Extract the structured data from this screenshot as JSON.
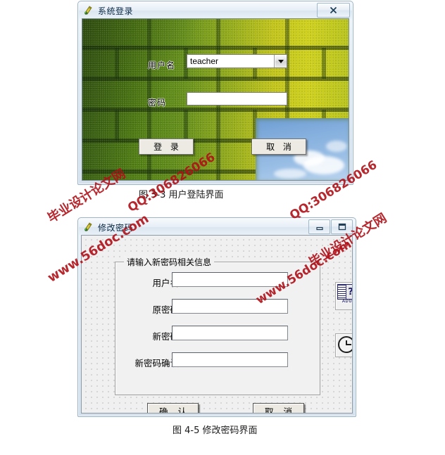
{
  "figures": [
    {
      "caption": "图 3-3 用户登陆界面",
      "window": {
        "title": "系统登录",
        "icon": "vb-form-icon",
        "buttons": [
          {
            "name": "close",
            "glyph": "✕"
          }
        ],
        "fields": [
          {
            "label": "用户名",
            "type": "combobox",
            "value": "teacher",
            "placeholder": ""
          },
          {
            "label": "密码",
            "type": "password",
            "value": "",
            "placeholder": ""
          }
        ],
        "actions": [
          {
            "name": "login",
            "label": "登 录"
          },
          {
            "name": "cancel",
            "label": "取 消"
          }
        ]
      }
    },
    {
      "caption": "图 4-5 修改密码界面",
      "window": {
        "title": "修改密码",
        "icon": "vb-form-icon",
        "buttons": [
          {
            "name": "minimize",
            "glyph": "—"
          },
          {
            "name": "maximize",
            "glyph": "▭"
          }
        ],
        "groupbox_title": "请输入新密码相关信息",
        "fields": [
          {
            "label": "用户名",
            "type": "text",
            "value": "",
            "placeholder": ""
          },
          {
            "label": "原密码",
            "type": "password",
            "value": "",
            "placeholder": ""
          },
          {
            "label": "新密码",
            "type": "password",
            "value": "",
            "placeholder": ""
          },
          {
            "label": "新密码确认",
            "type": "password",
            "value": "",
            "placeholder": ""
          }
        ],
        "actions": [
          {
            "name": "confirm",
            "label": "确 认"
          },
          {
            "name": "cancel",
            "label": "取 消"
          }
        ],
        "tools": [
          {
            "name": "ado-data-control",
            "label": "ADO",
            "glyph": "?"
          },
          {
            "name": "timer-control",
            "label": ""
          }
        ]
      }
    }
  ],
  "watermarks": [
    {
      "text": "毕业设计论文网",
      "id": "wm-site-1"
    },
    {
      "text": "QQ:306826066",
      "id": "wm-qq-1"
    },
    {
      "text": "www.56doc.com",
      "id": "wm-url-1"
    },
    {
      "text": "www.56doc.com",
      "id": "wm-url-2"
    },
    {
      "text": "毕业设计论文网",
      "id": "wm-site-2"
    },
    {
      "text": "QQ:306826066",
      "id": "wm-qq-2"
    }
  ],
  "colors": {
    "watermark": "#b01018",
    "titlebar_text": "#0b2a45",
    "form_bg": "#f0f0f0"
  }
}
